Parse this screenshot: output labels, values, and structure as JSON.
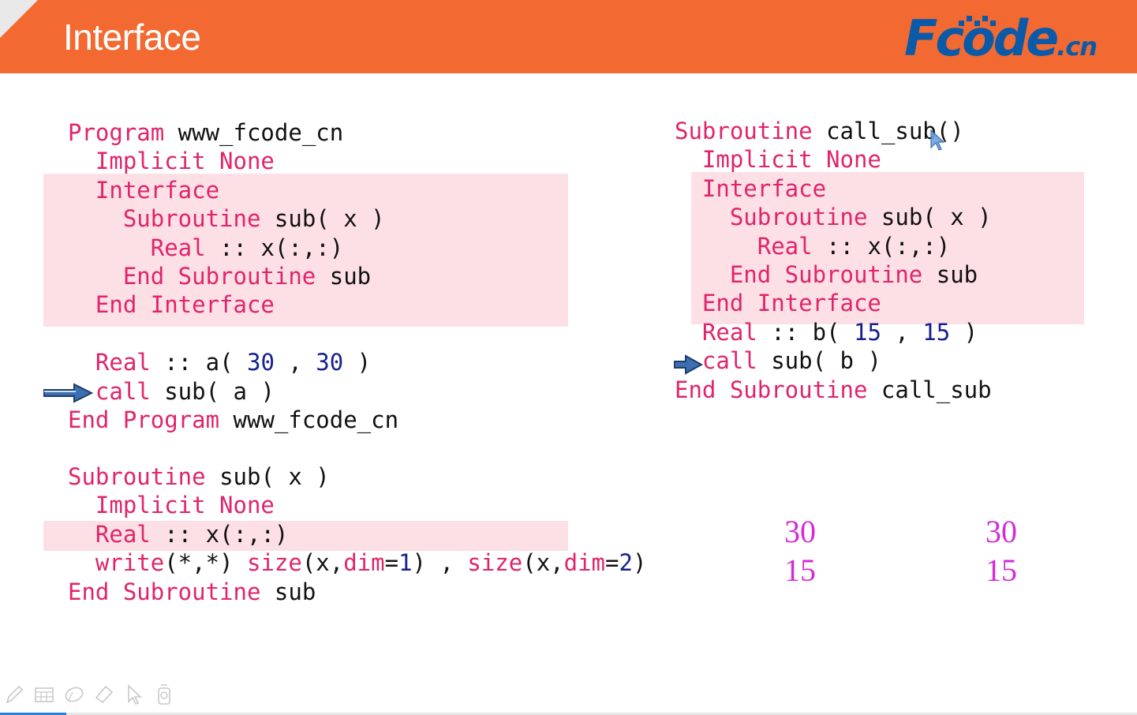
{
  "slide": {
    "title": "Interface",
    "logo": {
      "main": "Fcode",
      "suffix": ".cn"
    }
  },
  "left_program": {
    "lines": [
      [
        {
          "t": "Program",
          "c": "k"
        },
        {
          "t": " www_fcode_cn",
          "c": "p"
        }
      ],
      [
        {
          "t": "  Implicit None",
          "c": "k"
        }
      ],
      [
        {
          "t": "  Interface",
          "c": "k"
        }
      ],
      [
        {
          "t": "    Subroutine",
          "c": "k"
        },
        {
          "t": " sub( x )",
          "c": "p"
        }
      ],
      [
        {
          "t": "      Real",
          "c": "k"
        },
        {
          "t": " :: x(:,:)",
          "c": "p"
        }
      ],
      [
        {
          "t": "    End Subroutine",
          "c": "k"
        },
        {
          "t": " sub",
          "c": "p"
        }
      ],
      [
        {
          "t": "  End Interface",
          "c": "k"
        }
      ],
      [
        {
          "t": "",
          "c": "p"
        }
      ],
      [
        {
          "t": "  Real",
          "c": "k"
        },
        {
          "t": " :: a( ",
          "c": "p"
        },
        {
          "t": "30",
          "c": "n"
        },
        {
          "t": " , ",
          "c": "p"
        },
        {
          "t": "30",
          "c": "n"
        },
        {
          "t": " )",
          "c": "p"
        }
      ],
      [
        {
          "t": "  call",
          "c": "k"
        },
        {
          "t": " sub( a )",
          "c": "p"
        }
      ],
      [
        {
          "t": "End Program",
          "c": "k"
        },
        {
          "t": " www_fcode_cn",
          "c": "p"
        }
      ]
    ]
  },
  "left_subroutine": {
    "lines": [
      [
        {
          "t": "Subroutine",
          "c": "k"
        },
        {
          "t": " sub( x )",
          "c": "p"
        }
      ],
      [
        {
          "t": "  Implicit None",
          "c": "k"
        }
      ],
      [
        {
          "t": "  Real",
          "c": "k"
        },
        {
          "t": " :: x(:,:)",
          "c": "p"
        }
      ],
      [
        {
          "t": "  write",
          "c": "k"
        },
        {
          "t": "(*,*) ",
          "c": "p"
        },
        {
          "t": "size",
          "c": "k"
        },
        {
          "t": "(x,",
          "c": "p"
        },
        {
          "t": "dim",
          "c": "k"
        },
        {
          "t": "=",
          "c": "p"
        },
        {
          "t": "1",
          "c": "n"
        },
        {
          "t": ") , ",
          "c": "p"
        },
        {
          "t": "size",
          "c": "k"
        },
        {
          "t": "(x,",
          "c": "p"
        },
        {
          "t": "dim",
          "c": "k"
        },
        {
          "t": "=",
          "c": "p"
        },
        {
          "t": "2",
          "c": "n"
        },
        {
          "t": ")",
          "c": "p"
        }
      ],
      [
        {
          "t": "End Subroutine",
          "c": "k"
        },
        {
          "t": " sub",
          "c": "p"
        }
      ]
    ]
  },
  "right_subroutine": {
    "lines": [
      [
        {
          "t": "Subroutine",
          "c": "k"
        },
        {
          "t": " call_sub()",
          "c": "p"
        }
      ],
      [
        {
          "t": "  Implicit None",
          "c": "k"
        }
      ],
      [
        {
          "t": "  Interface",
          "c": "k"
        }
      ],
      [
        {
          "t": "    Subroutine",
          "c": "k"
        },
        {
          "t": " sub( x )",
          "c": "p"
        }
      ],
      [
        {
          "t": "      Real",
          "c": "k"
        },
        {
          "t": " :: x(:,:)",
          "c": "p"
        }
      ],
      [
        {
          "t": "    End Subroutine",
          "c": "k"
        },
        {
          "t": " sub",
          "c": "p"
        }
      ],
      [
        {
          "t": "  End Interface",
          "c": "k"
        }
      ],
      [
        {
          "t": "  Real",
          "c": "k"
        },
        {
          "t": " :: b( ",
          "c": "p"
        },
        {
          "t": "15",
          "c": "n"
        },
        {
          "t": " , ",
          "c": "p"
        },
        {
          "t": "15",
          "c": "n"
        },
        {
          "t": " )",
          "c": "p"
        }
      ],
      [
        {
          "t": "  call",
          "c": "k"
        },
        {
          "t": " sub( b )",
          "c": "p"
        }
      ],
      [
        {
          "t": "End Subroutine",
          "c": "k"
        },
        {
          "t": " call_sub",
          "c": "p"
        }
      ]
    ]
  },
  "output": {
    "row1": [
      "30",
      "30"
    ],
    "row2": [
      "15",
      "15"
    ]
  },
  "colors": {
    "header": "#f26a31",
    "keyword": "#e0246b",
    "number": "#16218f",
    "highlight": "#fde0e5",
    "output": "#d42ad8",
    "logo": "#0b5aa8"
  },
  "toolbar": {
    "icons": [
      "pen-icon",
      "slides-grid-icon",
      "eraser-icon",
      "highlighter-icon",
      "pointer-icon",
      "laser-pointer-icon"
    ]
  }
}
